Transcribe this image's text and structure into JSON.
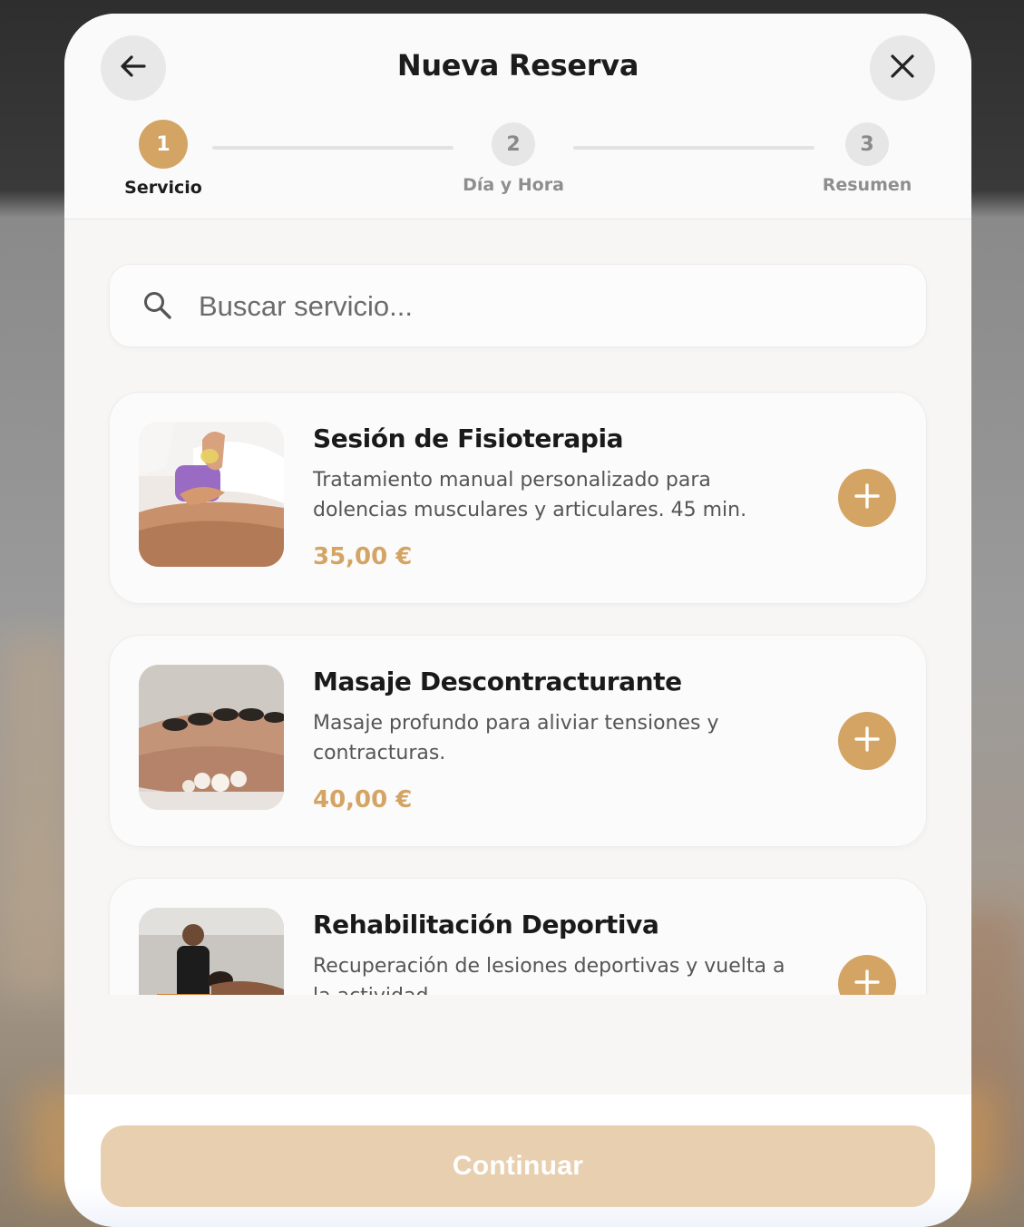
{
  "header": {
    "title": "Nueva Reserva",
    "back_icon": "arrow-left-icon",
    "close_icon": "close-icon"
  },
  "steps": [
    {
      "number": "1",
      "label": "Servicio",
      "state": "active"
    },
    {
      "number": "2",
      "label": "Día y Hora",
      "state": "inactive"
    },
    {
      "number": "3",
      "label": "Resumen",
      "state": "inactive"
    }
  ],
  "search": {
    "placeholder": "Buscar servicio...",
    "value": "",
    "icon": "search-icon"
  },
  "services": [
    {
      "title": "Sesión de Fisioterapia",
      "description": "Tratamiento manual personalizado para dolencias musculares y articulares. 45 min.",
      "price": "35,00 €"
    },
    {
      "title": "Masaje Descontracturante",
      "description": "Masaje profundo para aliviar tensiones y contracturas.",
      "price": "40,00 €"
    },
    {
      "title": "Rehabilitación Deportiva",
      "description": "Recuperación de lesiones deportivas y vuelta a la actividad.",
      "price": ""
    }
  ],
  "footer": {
    "continue_label": "Continuar"
  },
  "colors": {
    "accent": "#d4a464",
    "accent_disabled": "#e7cfaf",
    "text_primary": "#1c1c1c",
    "text_secondary": "#555555"
  }
}
